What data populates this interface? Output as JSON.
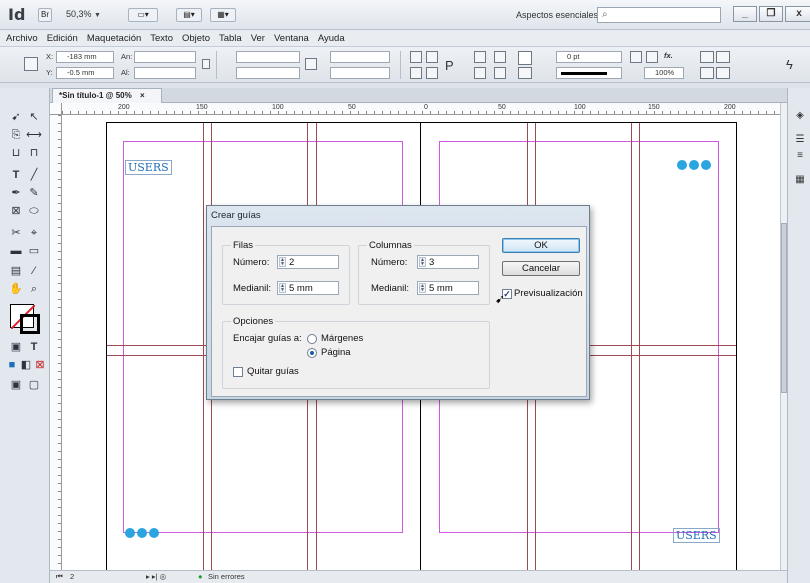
{
  "app": {
    "logo": "Id",
    "zoom": "50,3%",
    "workspace": "Aspectos esenciales",
    "window_buttons": [
      "_",
      "❐",
      "x"
    ]
  },
  "menu": [
    "Archivo",
    "Edición",
    "Maquetación",
    "Texto",
    "Objeto",
    "Tabla",
    "Ver",
    "Ventana",
    "Ayuda"
  ],
  "control": {
    "x_label": "X:",
    "x_value": "-183 mm",
    "y_label": "Y:",
    "y_value": "-0.5 mm",
    "w_label": "An:",
    "h_label": "Al:",
    "stroke_weight": "0 pt",
    "opacity": "100%"
  },
  "document": {
    "tab_title": "*Sin título-1 @ 50%",
    "tab_close": "×",
    "ruler_h": [
      "200",
      "150",
      "100",
      "50",
      "0",
      "50",
      "100",
      "150",
      "200"
    ]
  },
  "pages": {
    "left_text": "USERS",
    "right_text": "USERS"
  },
  "status": {
    "page": "2",
    "preflight": "Sin errores"
  },
  "dialog": {
    "title": "Crear guías",
    "rows": {
      "label": "Filas",
      "number_label": "Número:",
      "number_value": "2",
      "gutter_label": "Medianil:",
      "gutter_value": "5 mm"
    },
    "columns": {
      "label": "Columnas",
      "number_label": "Número:",
      "number_value": "3",
      "gutter_label": "Medianil:",
      "gutter_value": "5 mm"
    },
    "options": {
      "label": "Opciones",
      "fit_label": "Encajar guías a:",
      "margins_label": "Márgenes",
      "page_label": "Página",
      "remove_label": "Quitar guías"
    },
    "ok_label": "OK",
    "cancel_label": "Cancelar",
    "preview_label": "Previsualización",
    "preview_checked": "✓"
  }
}
